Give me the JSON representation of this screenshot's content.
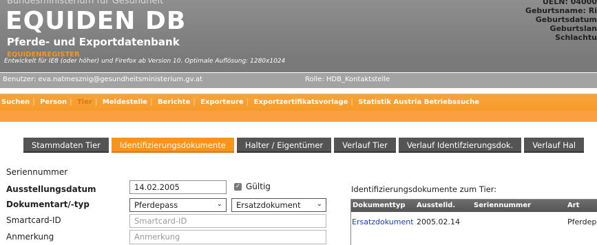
{
  "header": {
    "ministry": "Bundesministerium für Gesundheit",
    "title": "EQUIDEN DB",
    "subtitle": "Pferde- und Exportdatenbank",
    "registry": "EQUIDENREGISTER",
    "devnote": "Entwickelt für IE8 (oder höher) und Firefox ab Version 10. Optimale Auflösung: 1280x1024",
    "right_lines": [
      "UELN: 04000",
      "Geburtsname: Ri",
      "Geburtsdatum",
      "Geburtslan",
      "Schlachtu"
    ]
  },
  "userbar": {
    "user": "Benutzer: eva.natmesznig@gesundheitsministerium.gv.at",
    "role": "Rolle: HDB_Kontaktstelle"
  },
  "nav": {
    "items": [
      "Suchen",
      "Person",
      "Tier",
      "Meldestelle",
      "Berichte",
      "Exporteure",
      "Exportzertifikatsvorlage",
      "Statistik Austria Betriebssuche"
    ]
  },
  "tabs": [
    "Stammdaten Tier",
    "Identifizierungsdokumente",
    "Halter / Eigentümer",
    "Verlauf Tier",
    "Verlauf Identifzierungsdok.",
    "Verlauf Hal"
  ],
  "form": {
    "seriennummer_label": "Seriennummer",
    "ausstellungsdatum_label": "Ausstellungsdatum",
    "ausstellungsdatum_value": "14.02.2005",
    "gueltig_label": "Gültig",
    "dokumentart_label": "Dokumentart/-typ",
    "dokumentart_value": "Pferdepass",
    "typ_value": "Ersatzdokument",
    "smartcard_label": "Smartcard-ID",
    "smartcard_placeholder": "Smartcard-ID",
    "anmerkung_label": "Anmerkung",
    "anmerkung_placeholder": "Anmerkung"
  },
  "documents": {
    "title": "Identifizierungsdokumente zum Tier:",
    "columns": [
      "Dokumenttyp",
      "Ausstelld.",
      "Seriennummer",
      "Art"
    ],
    "rows": [
      {
        "dokumenttyp": "Ersatzdokument",
        "ausstelld": "2005.02.14",
        "seriennummer": "",
        "art": "Pferdep"
      }
    ]
  },
  "colors": {
    "accent": "#f7931e",
    "header_gray": "#7a7a7a",
    "tab_dark": "#545454",
    "link": "#1a3fb5"
  }
}
